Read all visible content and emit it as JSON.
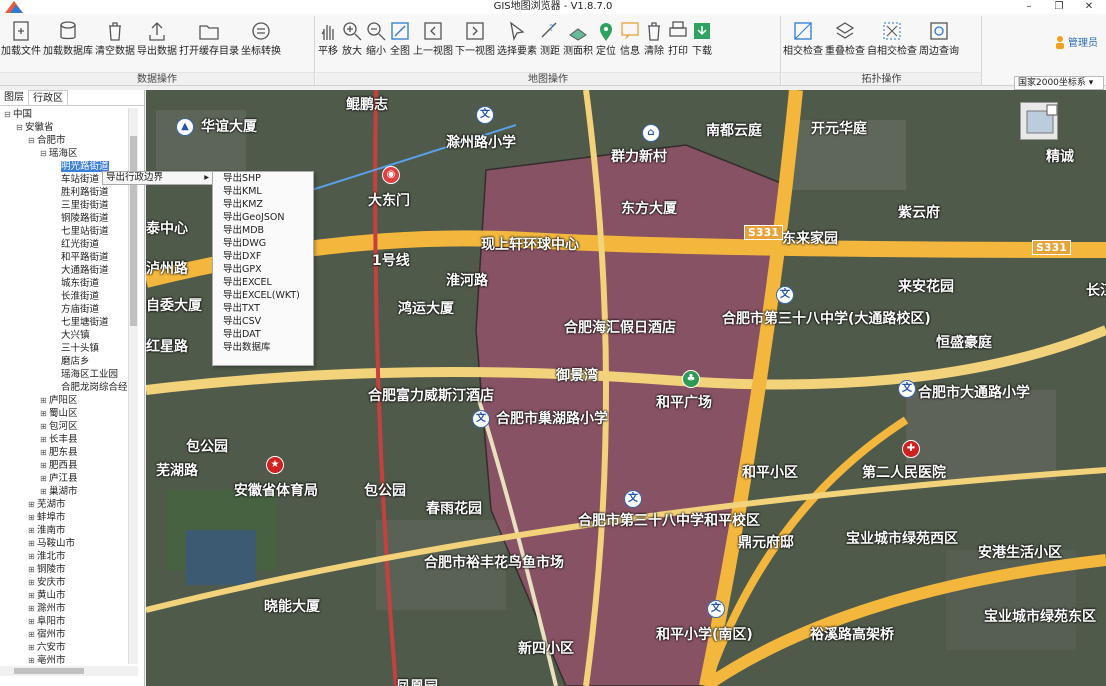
{
  "window": {
    "title": "GIS地图浏览器 - V1.8.7.0",
    "minimize": "–",
    "restore": "❐",
    "close": "✕"
  },
  "ribbon": {
    "groups": [
      {
        "label": "数据操作",
        "buttons": [
          {
            "label": "加载文件",
            "icon": "add-file-icon"
          },
          {
            "label": "加载数据库",
            "icon": "database-icon"
          },
          {
            "label": "清空数据",
            "icon": "trash-icon"
          },
          {
            "label": "导出数据",
            "icon": "export-icon"
          },
          {
            "label": "打开缓存目录",
            "icon": "folder-icon"
          },
          {
            "label": "坐标转换",
            "icon": "coordinate-convert-icon"
          }
        ]
      },
      {
        "label": "地图操作",
        "buttons": [
          {
            "label": "平移",
            "icon": "hand-icon"
          },
          {
            "label": "放大",
            "icon": "zoom-in-icon"
          },
          {
            "label": "缩小",
            "icon": "zoom-out-icon"
          },
          {
            "label": "全图",
            "icon": "full-extent-icon"
          },
          {
            "label": "上一视图",
            "icon": "prev-view-icon"
          },
          {
            "label": "下一视图",
            "icon": "next-view-icon"
          },
          {
            "label": "选择要素",
            "icon": "select-icon"
          },
          {
            "label": "测距",
            "icon": "measure-distance-icon"
          },
          {
            "label": "测面积",
            "icon": "measure-area-icon"
          },
          {
            "label": "定位",
            "icon": "locate-icon"
          },
          {
            "label": "信息",
            "icon": "info-icon"
          },
          {
            "label": "清除",
            "icon": "clear-icon"
          },
          {
            "label": "打印",
            "icon": "print-icon"
          },
          {
            "label": "下载",
            "icon": "download-icon"
          }
        ]
      },
      {
        "label": "拓扑操作",
        "buttons": [
          {
            "label": "相交检查",
            "icon": "intersect-icon"
          },
          {
            "label": "重叠检查",
            "icon": "overlap-icon"
          },
          {
            "label": "自相交检查",
            "icon": "self-intersect-icon"
          },
          {
            "label": "周边查询",
            "icon": "nearby-query-icon"
          }
        ]
      }
    ],
    "user": "管理员",
    "coord_system": "国家2000坐标系"
  },
  "panel": {
    "tabs": [
      "图层",
      "行政区"
    ],
    "tree": [
      {
        "label": "中国",
        "level": 0,
        "toggle": "⊟"
      },
      {
        "label": "安徽省",
        "level": 1,
        "toggle": "⊟"
      },
      {
        "label": "合肥市",
        "level": 2,
        "toggle": "⊟"
      },
      {
        "label": "瑶海区",
        "level": 3,
        "toggle": "⊟"
      },
      {
        "label": "明光路街道",
        "level": 4,
        "toggle": "",
        "selected": true
      },
      {
        "label": "车站街道",
        "level": 4,
        "toggle": ""
      },
      {
        "label": "胜利路街道",
        "level": 4,
        "toggle": ""
      },
      {
        "label": "三里街街道",
        "level": 4,
        "toggle": ""
      },
      {
        "label": "铜陵路街道",
        "level": 4,
        "toggle": ""
      },
      {
        "label": "七里站街道",
        "level": 4,
        "toggle": ""
      },
      {
        "label": "红光街道",
        "level": 4,
        "toggle": ""
      },
      {
        "label": "和平路街道",
        "level": 4,
        "toggle": ""
      },
      {
        "label": "大通路街道",
        "level": 4,
        "toggle": ""
      },
      {
        "label": "城东街道",
        "level": 4,
        "toggle": ""
      },
      {
        "label": "长淮街道",
        "level": 4,
        "toggle": ""
      },
      {
        "label": "方庙街道",
        "level": 4,
        "toggle": ""
      },
      {
        "label": "七里塘街道",
        "level": 4,
        "toggle": ""
      },
      {
        "label": "大兴镇",
        "level": 4,
        "toggle": ""
      },
      {
        "label": "三十头镇",
        "level": 4,
        "toggle": ""
      },
      {
        "label": "磨店乡",
        "level": 4,
        "toggle": ""
      },
      {
        "label": "瑶海区工业园",
        "level": 4,
        "toggle": ""
      },
      {
        "label": "合肥龙岗综合经济开发区",
        "level": 4,
        "toggle": ""
      },
      {
        "label": "庐阳区",
        "level": 3,
        "toggle": "⊞"
      },
      {
        "label": "蜀山区",
        "level": 3,
        "toggle": "⊞"
      },
      {
        "label": "包河区",
        "level": 3,
        "toggle": "⊞"
      },
      {
        "label": "长丰县",
        "level": 3,
        "toggle": "⊞"
      },
      {
        "label": "肥东县",
        "level": 3,
        "toggle": "⊞"
      },
      {
        "label": "肥西县",
        "level": 3,
        "toggle": "⊞"
      },
      {
        "label": "庐江县",
        "level": 3,
        "toggle": "⊞"
      },
      {
        "label": "巢湖市",
        "level": 3,
        "toggle": "⊞"
      },
      {
        "label": "芜湖市",
        "level": 2,
        "toggle": "⊞"
      },
      {
        "label": "蚌埠市",
        "level": 2,
        "toggle": "⊞"
      },
      {
        "label": "淮南市",
        "level": 2,
        "toggle": "⊞"
      },
      {
        "label": "马鞍山市",
        "level": 2,
        "toggle": "⊞"
      },
      {
        "label": "淮北市",
        "level": 2,
        "toggle": "⊞"
      },
      {
        "label": "铜陵市",
        "level": 2,
        "toggle": "⊞"
      },
      {
        "label": "安庆市",
        "level": 2,
        "toggle": "⊞"
      },
      {
        "label": "黄山市",
        "level": 2,
        "toggle": "⊞"
      },
      {
        "label": "滁州市",
        "level": 2,
        "toggle": "⊞"
      },
      {
        "label": "阜阳市",
        "level": 2,
        "toggle": "⊞"
      },
      {
        "label": "宿州市",
        "level": 2,
        "toggle": "⊞"
      },
      {
        "label": "六安市",
        "level": 2,
        "toggle": "⊞"
      },
      {
        "label": "亳州市",
        "level": 2,
        "toggle": "⊞"
      }
    ]
  },
  "context_menu": {
    "item": "导出行政边界",
    "arrow": "▸"
  },
  "export_menu": [
    "导出SHP",
    "导出KML",
    "导出KMZ",
    "导出GeoJSON",
    "导出MDB",
    "导出DWG",
    "导出DXF",
    "导出GPX",
    "导出EXCEL",
    "导出EXCEL(WKT)",
    "导出TXT",
    "导出CSV",
    "导出DAT",
    "导出数据库"
  ],
  "map": {
    "labels": [
      "华谊大厦",
      "鲲鹏志",
      "滁州路小学",
      "南都云庭",
      "开元华庭",
      "精诚",
      "群力新村",
      "东方大厦",
      "紫云府",
      "大东门",
      "东来家园",
      "现上轩环球中心",
      "泰中心",
      "鸿运大厦",
      "合肥海汇假日酒店",
      "合肥市第三十八中学(大通路校区)",
      "御景湾",
      "恒盛豪庭",
      "来安花园",
      "红星路",
      "合肥富力威斯汀酒店",
      "合肥市巢湖路小学",
      "和平广场",
      "合肥市大通路小学",
      "包公园",
      "安徽省体育局",
      "包公园",
      "春雨花园",
      "和平小区",
      "第二人民医院",
      "合肥市第三十八中学和平校区",
      "宝业城市绿苑西区",
      "安港生活小区",
      "晓能大厦",
      "合肥市裕丰花鸟鱼市场",
      "新四小区",
      "和平小学(南区)",
      "裕溪路高架桥",
      "宝业城市绿苑东区",
      "鼎元府邸",
      "凤凰园",
      "芜湖路",
      "泸州路",
      "淮河路",
      "1号线",
      "自委大厦",
      "长江东"
    ],
    "road_badges": [
      "S331",
      "S331"
    ]
  },
  "colors": {
    "selection": "#3c7fd8",
    "boundary_fill": "#a0506e",
    "road": "#f3b73d"
  }
}
